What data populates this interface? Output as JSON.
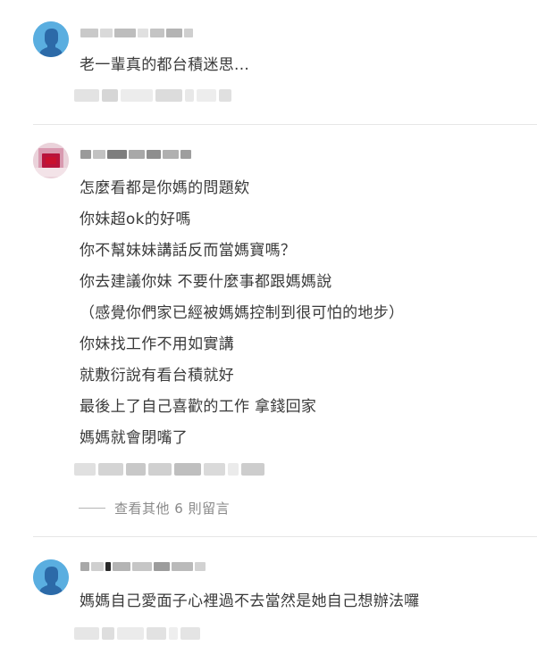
{
  "colors": {
    "text": "#3a3a3a",
    "muted": "#8a8a8a",
    "avatar_blue": "#5aaee0",
    "divider": "#e6e6e6"
  },
  "comments": [
    {
      "avatar": "default-user-icon",
      "lines": [
        "老一輩真的都台積迷思..."
      ]
    },
    {
      "avatar": "pixelated-photo",
      "lines": [
        "怎麼看都是你媽的問題欸",
        "你妹超ok的好嗎",
        "你不幫妹妹講話反而當媽寶嗎？",
        "你去建議你妹 不要什麼事都跟媽媽說",
        "（感覺你們家已經被媽媽控制到很可怕的地步）",
        "你妹找工作不用如實講",
        "就敷衍說有看台積就好",
        "最後上了自己喜歡的工作 拿錢回家",
        "媽媽就會閉嘴了"
      ],
      "more_replies": "查看其他 6 則留言"
    },
    {
      "avatar": "default-user-icon",
      "lines": [
        "媽媽自己愛面子心裡過不去當然是她自己想辦法囉"
      ]
    }
  ]
}
